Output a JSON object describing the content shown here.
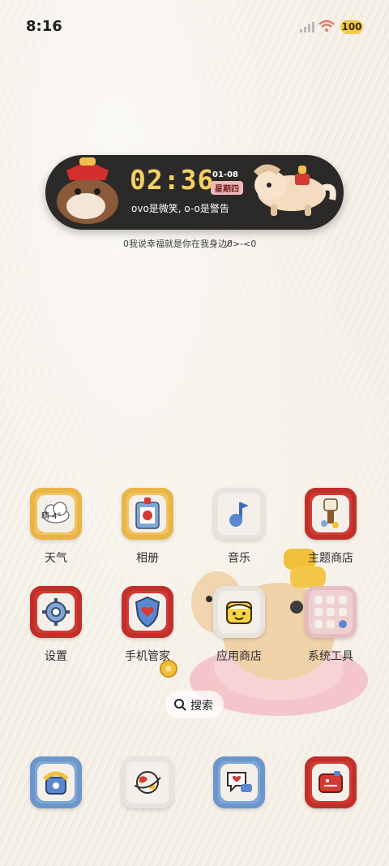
{
  "status_bar": {
    "time": "8:16",
    "battery": "100"
  },
  "widget": {
    "clock": "02:36",
    "date": "01-08",
    "weekday": "星期四",
    "motto": "ovo是微笑, o-o是警告"
  },
  "tagline": "0我说幸福就是你在我身边0̸̸>-<0",
  "apps_row1": [
    {
      "label": "天气",
      "sub": "晴 4°"
    },
    {
      "label": "相册"
    },
    {
      "label": "音乐"
    },
    {
      "label": "主题商店"
    }
  ],
  "apps_row2": [
    {
      "label": "设置"
    },
    {
      "label": "手机管家"
    },
    {
      "label": "应用商店"
    },
    {
      "label": "系统工具"
    }
  ],
  "search": {
    "label": "搜索"
  },
  "colors": {
    "accent": "#f4cf63",
    "widget_bg": "#2c2a28"
  }
}
